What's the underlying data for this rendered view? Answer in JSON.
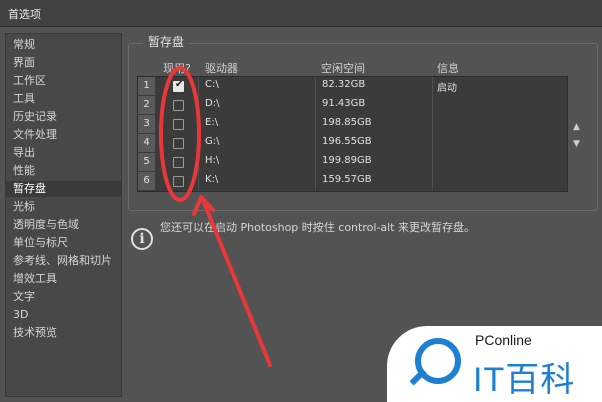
{
  "window": {
    "title": "首选项"
  },
  "sidebar": {
    "items": [
      {
        "label": "常规"
      },
      {
        "label": "界面"
      },
      {
        "label": "工作区"
      },
      {
        "label": "工具"
      },
      {
        "label": "历史记录"
      },
      {
        "label": "文件处理"
      },
      {
        "label": "导出"
      },
      {
        "label": "性能"
      },
      {
        "label": "暂存盘",
        "active": true
      },
      {
        "label": "光标"
      },
      {
        "label": "透明度与色域"
      },
      {
        "label": "单位与标尺"
      },
      {
        "label": "参考线、网格和切片"
      },
      {
        "label": "增效工具"
      },
      {
        "label": "文字"
      },
      {
        "label": "3D"
      },
      {
        "label": "技术预览"
      }
    ]
  },
  "scratch": {
    "section_title": "暂存盘",
    "columns": {
      "active": "现用?",
      "drive": "驱动器",
      "free": "空闲空间",
      "info": "信息"
    },
    "rows": [
      {
        "num": "1",
        "checked": true,
        "drive": "C:\\",
        "free": "82.32GB",
        "info": "启动"
      },
      {
        "num": "2",
        "checked": false,
        "drive": "D:\\",
        "free": "91.43GB",
        "info": ""
      },
      {
        "num": "3",
        "checked": false,
        "drive": "E:\\",
        "free": "198.85GB",
        "info": ""
      },
      {
        "num": "4",
        "checked": false,
        "drive": "G:\\",
        "free": "196.55GB",
        "info": ""
      },
      {
        "num": "5",
        "checked": false,
        "drive": "H:\\",
        "free": "199.89GB",
        "info": ""
      },
      {
        "num": "6",
        "checked": false,
        "drive": "K:\\",
        "free": "159.57GB",
        "info": ""
      }
    ],
    "check_glyph": "✔",
    "up_arrow": "▲",
    "down_arrow": "▼"
  },
  "info": {
    "icon": "i",
    "text": "您还可以在启动 Photoshop 时按住 control-alt 来更改暂存盘。"
  },
  "watermark": {
    "brand": "PConline",
    "title": "IT百科"
  },
  "colors": {
    "annotation": "#e8383a",
    "accent": "#1e80d2"
  }
}
